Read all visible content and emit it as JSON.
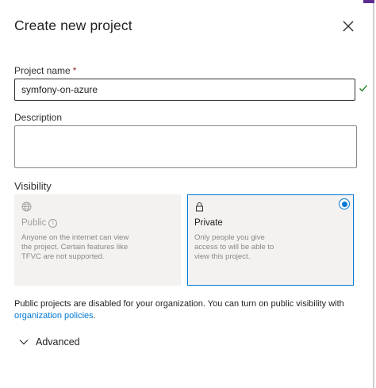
{
  "dialog": {
    "title": "Create new project"
  },
  "project_name": {
    "label": "Project name",
    "required_marker": "*",
    "value": "symfony-on-azure"
  },
  "description": {
    "label": "Description",
    "value": ""
  },
  "visibility": {
    "label": "Visibility",
    "selected": "private",
    "options": [
      {
        "id": "public",
        "title": "Public",
        "description": "Anyone on the internet can view the project. Certain features like TFVC are not supported.",
        "icon": "globe-icon",
        "disabled": true
      },
      {
        "id": "private",
        "title": "Private",
        "description": "Only people you give access to will be able to view this project.",
        "icon": "lock-icon",
        "disabled": false
      }
    ]
  },
  "notice": {
    "text": "Public projects are disabled for your organization. You can turn on public visibility with",
    "link_text": "organization policies",
    "suffix": "."
  },
  "advanced": {
    "label": "Advanced",
    "expanded": false
  },
  "colors": {
    "accent": "#0078d4",
    "required": "#a4262c",
    "card_bg": "#f3f2f1",
    "valid": "#107c10"
  }
}
